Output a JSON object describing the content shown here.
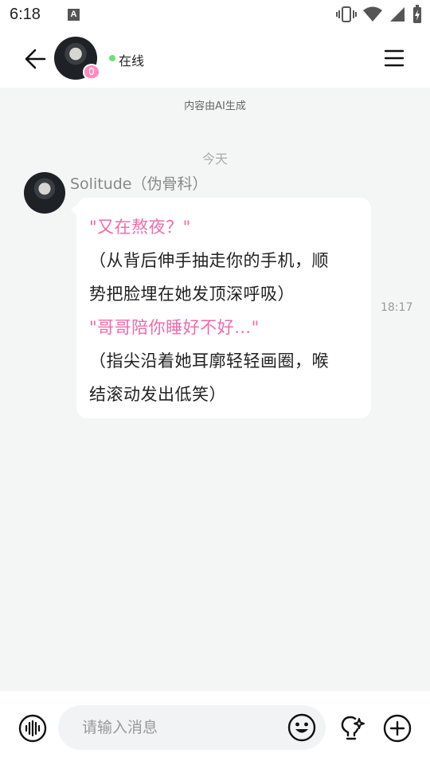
{
  "status_bar": {
    "time": "6:18",
    "notification_glyph": "A"
  },
  "header": {
    "badge_count": "0",
    "status_text": "在线",
    "colors": {
      "online": "#6ede79",
      "badge": "#ff8bc1"
    }
  },
  "chat": {
    "ai_notice": "内容由AI生成",
    "date_separator": "今天",
    "messages": [
      {
        "sender": "Solitude（伪骨科）",
        "time": "18:17",
        "lines": [
          {
            "text": "\"又在熬夜？\"",
            "style": "pink"
          },
          {
            "text": "（从背后伸手抽走你的手机，顺",
            "style": "dark"
          },
          {
            "text": "势把脸埋在她发顶深呼吸）",
            "style": "dark"
          },
          {
            "text": "\"哥哥陪你睡好不好…\"",
            "style": "pink"
          },
          {
            "text": "（指尖沿着她耳廓轻轻画圈，喉",
            "style": "dark"
          },
          {
            "text": "结滚动发出低笑）",
            "style": "dark"
          }
        ]
      }
    ],
    "colors": {
      "speech": "#f06aaa",
      "action": "#222222"
    }
  },
  "input_bar": {
    "placeholder": "请输入消息",
    "value": "",
    "icons": [
      "voice-icon",
      "emoji-icon",
      "lightbulb-icon",
      "plus-icon"
    ]
  }
}
